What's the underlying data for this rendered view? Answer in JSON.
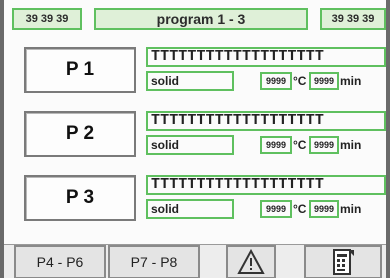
{
  "header": {
    "left_text": "39 39 39",
    "title": "program 1 - 3",
    "right_text": "39 39 39"
  },
  "programs": [
    {
      "label": "P 1",
      "name": "TTTTTTTTTTTTTTTTTTT",
      "type": "solid",
      "temp": "9999",
      "temp_unit": "°C",
      "time": "9999",
      "time_unit": "min"
    },
    {
      "label": "P 2",
      "name": "TTTTTTTTTTTTTTTTTTT",
      "type": "solid",
      "temp": "9999",
      "temp_unit": "°C",
      "time": "9999",
      "time_unit": "min"
    },
    {
      "label": "P 3",
      "name": "TTTTTTTTTTTTTTTTTTT",
      "type": "solid",
      "temp": "9999",
      "temp_unit": "°C",
      "time": "9999",
      "time_unit": "min"
    }
  ],
  "bottom": {
    "btn1": "P4 - P6",
    "btn2": "P7 - P8",
    "warning_icon": "warning-triangle-icon",
    "doc_icon": "document-icon"
  },
  "colors": {
    "field_border": "#5fc05f",
    "header_fill": "#dff0d8"
  }
}
